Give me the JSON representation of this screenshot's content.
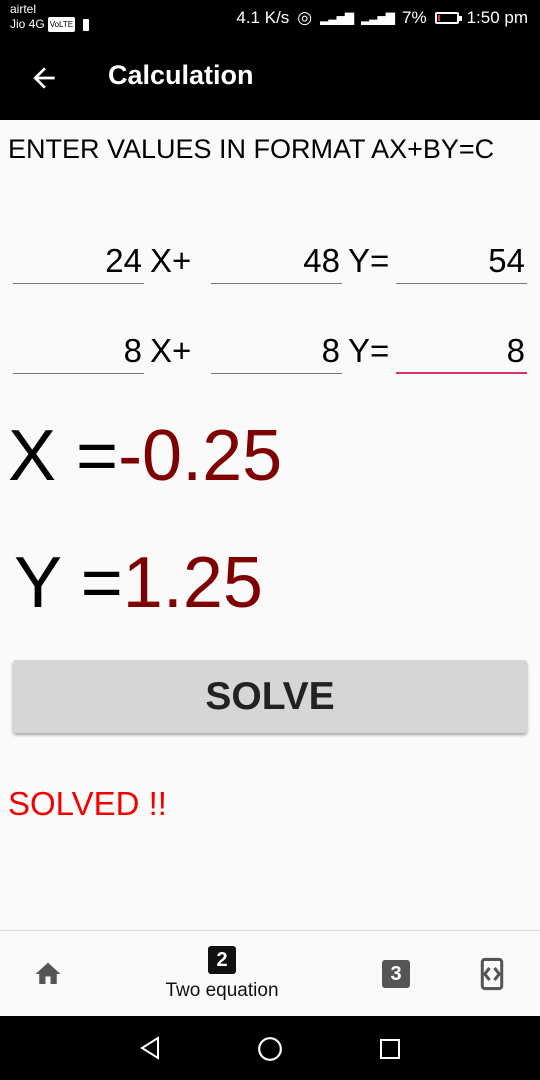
{
  "status_bar": {
    "carrier1": "airtel",
    "carrier2": "Jio 4G",
    "volte": "VoLTE",
    "speed": "4.1 K/s",
    "battery": "7%",
    "time": "1:50 pm"
  },
  "appbar": {
    "title": "Calculation"
  },
  "instructions": "ENTER VALUES IN FORMAT AX+BY=C",
  "equations": [
    {
      "a": "24",
      "x_label": "X+",
      "b": "48",
      "y_label": "Y=",
      "c": "54"
    },
    {
      "a": "8",
      "x_label": "X+",
      "b": "8",
      "y_label": "Y=",
      "c": "8"
    }
  ],
  "results": {
    "x_label": "X =",
    "x_value": "-0.25",
    "y_label": "Y =",
    "y_value": "1.25"
  },
  "solve_button": "SOLVE",
  "status_message": "SOLVED !!",
  "bottom_nav": {
    "items": [
      {
        "icon": "home-icon"
      },
      {
        "icon": "two-square-icon",
        "badge": "2",
        "label": "Two equation"
      },
      {
        "icon": "three-square-icon",
        "badge": "3"
      },
      {
        "icon": "code-expand-icon"
      }
    ]
  },
  "colors": {
    "result_value": "#7f0000",
    "status": "#f50000",
    "focus_underline": "#d6336c"
  }
}
